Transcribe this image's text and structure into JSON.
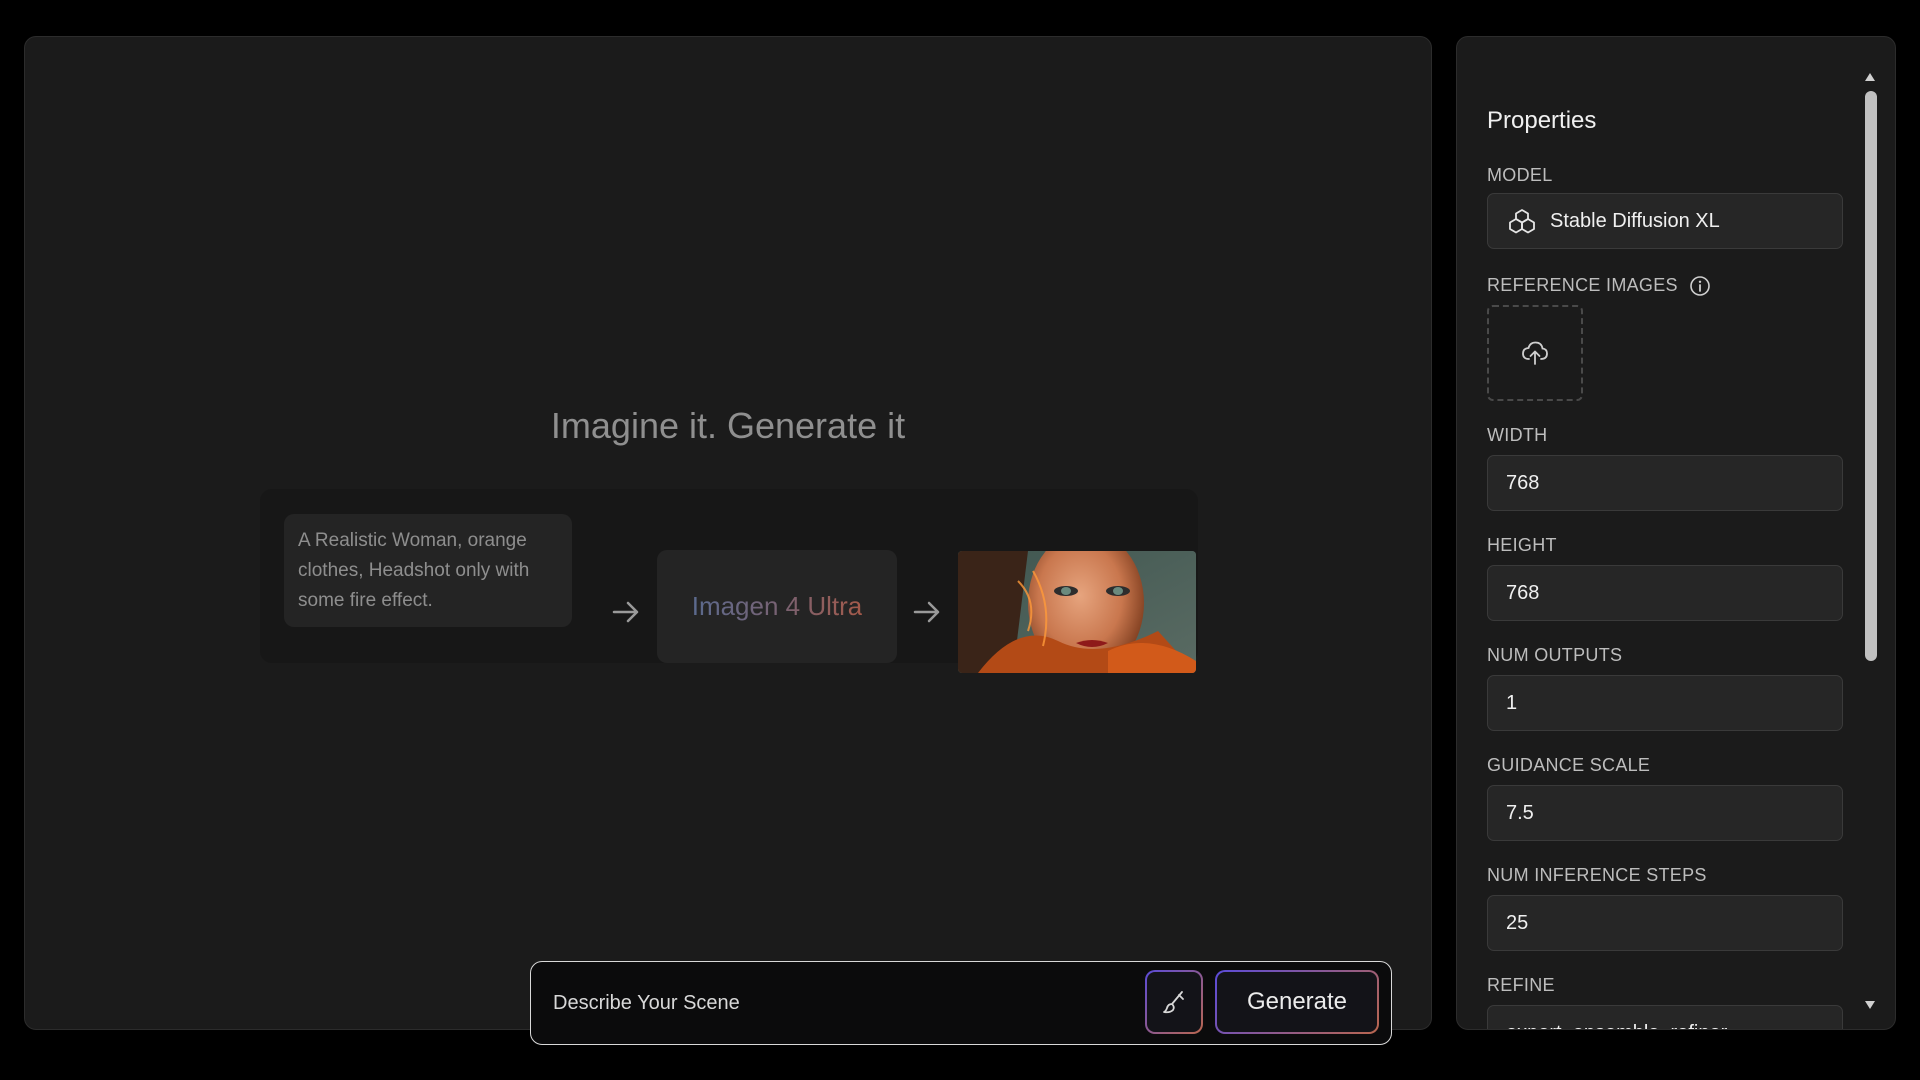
{
  "canvas": {
    "hero_title": "Imagine it. Generate it",
    "example_prompt": "A Realistic Woman, orange clothes, Headshot only with some fire effect.",
    "example_model_a": "Imagen 4 ",
    "example_model_b": "Ultra"
  },
  "prompt_bar": {
    "placeholder": "Describe Your Scene",
    "generate_label": "Generate"
  },
  "properties": {
    "title": "Properties",
    "model_label": "MODEL",
    "model_value": "Stable Diffusion XL",
    "reference_label": "REFERENCE IMAGES",
    "width_label": "WIDTH",
    "width_value": "768",
    "height_label": "HEIGHT",
    "height_value": "768",
    "num_outputs_label": "NUM OUTPUTS",
    "num_outputs_value": "1",
    "guidance_label": "GUIDANCE SCALE",
    "guidance_value": "7.5",
    "steps_label": "NUM INFERENCE STEPS",
    "steps_value": "25",
    "refine_label": "REFINE",
    "refine_value": "expert_ensemble_refiner"
  },
  "colors": {
    "background": "#000000",
    "panel": "#1b1b1b",
    "accent_start": "#5b4bd8",
    "accent_end": "#b9664e"
  },
  "icons": {
    "model": "cubes-icon",
    "upload": "cloud-upload-icon",
    "info": "info-icon",
    "brush": "brush-icon",
    "arrow": "arrow-right-icon"
  }
}
